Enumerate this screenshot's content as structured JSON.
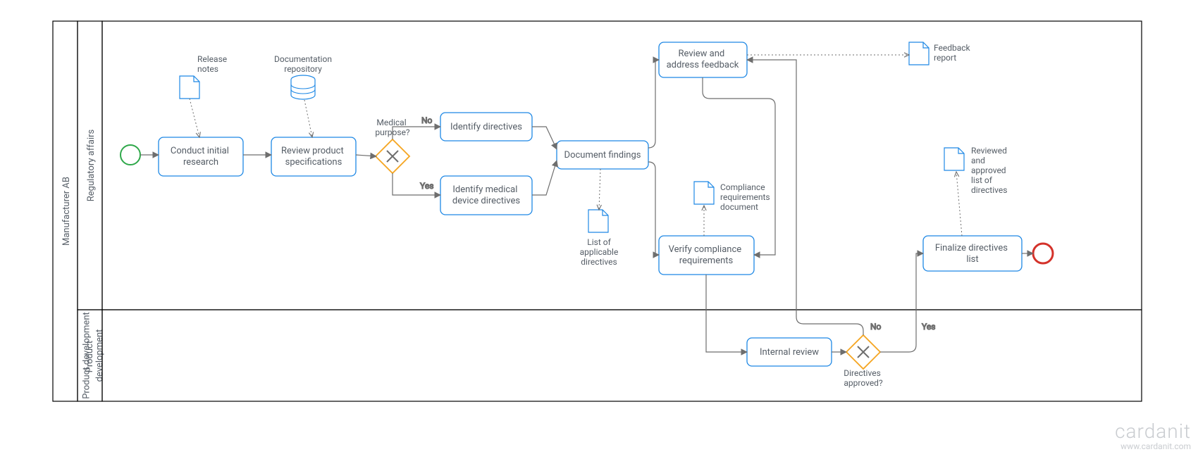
{
  "pool": {
    "name": "Manufacturer AB"
  },
  "lanes": {
    "reg": "Regulatory affairs",
    "pd": "Product\ndevelopment"
  },
  "tasks": {
    "research": "Conduct initial\nresearch",
    "review_spec": "Review product\nspecifications",
    "identify_dir": "Identify  directives",
    "identify_med": "Identify medical\ndevice directives",
    "doc_findings": "Document findings",
    "review_feedback": "Review and\naddress feedback",
    "verify_comp": "Verify compliance\nrequirements",
    "internal_review": "Internal review",
    "finalize": "Finalize directives\nlist"
  },
  "gateways": {
    "g1": "Medical\npurpose?",
    "g2": "Directives\napproved?"
  },
  "edges": {
    "no": "No",
    "yes": "Yes"
  },
  "artifacts": {
    "release_notes": "Release\nnotes",
    "doc_repo": "Documentation\nrepository",
    "list_dir": "List of\napplicable\ndirectives",
    "feedback_report": "Feedback\nreport",
    "compliance_doc": "Compliance\nrequirements\ndocument",
    "reviewed_list": "Reviewed\nand\napproved\nlist of\ndirectives"
  },
  "branding": {
    "name": "cardanit",
    "url": "www.cardanit.com"
  },
  "chart_data": {
    "type": "bpmn",
    "pool": "Manufacturer AB",
    "lanes": [
      "Regulatory affairs",
      "Product development"
    ],
    "nodes": [
      {
        "id": "start",
        "type": "startEvent",
        "lane": "Regulatory affairs"
      },
      {
        "id": "research",
        "type": "task",
        "lane": "Regulatory affairs",
        "label": "Conduct initial research"
      },
      {
        "id": "review_spec",
        "type": "task",
        "lane": "Regulatory affairs",
        "label": "Review product specifications"
      },
      {
        "id": "g1",
        "type": "exclusiveGateway",
        "lane": "Regulatory affairs",
        "label": "Medical purpose?"
      },
      {
        "id": "identify_dir",
        "type": "task",
        "lane": "Regulatory affairs",
        "label": "Identify directives"
      },
      {
        "id": "identify_med",
        "type": "task",
        "lane": "Regulatory affairs",
        "label": "Identify medical device directives"
      },
      {
        "id": "doc_findings",
        "type": "task",
        "lane": "Regulatory affairs",
        "label": "Document findings"
      },
      {
        "id": "review_feedback",
        "type": "task",
        "lane": "Regulatory affairs",
        "label": "Review and address feedback"
      },
      {
        "id": "verify_comp",
        "type": "task",
        "lane": "Regulatory affairs",
        "label": "Verify compliance requirements"
      },
      {
        "id": "finalize",
        "type": "task",
        "lane": "Regulatory affairs",
        "label": "Finalize directives list"
      },
      {
        "id": "end",
        "type": "endEvent",
        "lane": "Regulatory affairs"
      },
      {
        "id": "internal_review",
        "type": "task",
        "lane": "Product development",
        "label": "Internal review"
      },
      {
        "id": "g2",
        "type": "exclusiveGateway",
        "lane": "Product development",
        "label": "Directives approved?"
      }
    ],
    "sequenceFlows": [
      {
        "from": "start",
        "to": "research"
      },
      {
        "from": "research",
        "to": "review_spec"
      },
      {
        "from": "review_spec",
        "to": "g1"
      },
      {
        "from": "g1",
        "to": "identify_dir",
        "condition": "No"
      },
      {
        "from": "g1",
        "to": "identify_med",
        "condition": "Yes"
      },
      {
        "from": "identify_dir",
        "to": "doc_findings"
      },
      {
        "from": "identify_med",
        "to": "doc_findings"
      },
      {
        "from": "doc_findings",
        "to": "review_feedback"
      },
      {
        "from": "doc_findings",
        "to": "verify_comp"
      },
      {
        "from": "verify_comp",
        "to": "internal_review"
      },
      {
        "from": "internal_review",
        "to": "g2"
      },
      {
        "from": "g2",
        "to": "review_feedback",
        "condition": "No"
      },
      {
        "from": "g2",
        "to": "finalize",
        "condition": "Yes"
      },
      {
        "from": "review_feedback",
        "to": "verify_comp"
      },
      {
        "from": "finalize",
        "to": "end"
      }
    ],
    "dataObjects": [
      {
        "id": "release_notes",
        "label": "Release notes",
        "attachedTo": "research",
        "direction": "output"
      },
      {
        "id": "doc_repo",
        "type": "dataStore",
        "label": "Documentation repository",
        "attachedTo": "review_spec",
        "direction": "input"
      },
      {
        "id": "list_dir",
        "label": "List of applicable directives",
        "attachedTo": "doc_findings",
        "direction": "output"
      },
      {
        "id": "feedback_report",
        "label": "Feedback report",
        "attachedTo": "review_feedback",
        "direction": "output"
      },
      {
        "id": "compliance_doc",
        "label": "Compliance requirements document",
        "attachedTo": "verify_comp",
        "direction": "output"
      },
      {
        "id": "reviewed_list",
        "label": "Reviewed and approved list of directives",
        "attachedTo": "finalize",
        "direction": "output"
      }
    ]
  }
}
